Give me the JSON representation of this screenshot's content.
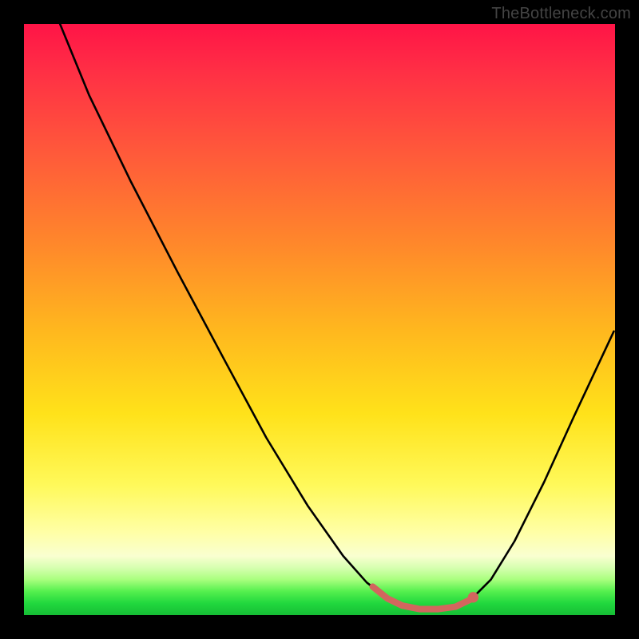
{
  "watermark": "TheBottleneck.com",
  "colors": {
    "frame": "#000000",
    "curve_stroke": "#000000",
    "highlight_stroke": "#d2665e",
    "gradient_top": "#ff1447",
    "gradient_bottom": "#16be35"
  },
  "chart_data": {
    "type": "line",
    "title": "",
    "xlabel": "",
    "ylabel": "",
    "xlim": [
      0,
      100
    ],
    "ylim": [
      0,
      100
    ],
    "curve": [
      {
        "x": 6.1,
        "y": 100.0
      },
      {
        "x": 11.0,
        "y": 88.0
      },
      {
        "x": 18.0,
        "y": 73.5
      },
      {
        "x": 26.0,
        "y": 58.0
      },
      {
        "x": 34.0,
        "y": 43.0
      },
      {
        "x": 41.0,
        "y": 30.0
      },
      {
        "x": 48.0,
        "y": 18.5
      },
      {
        "x": 54.0,
        "y": 10.0
      },
      {
        "x": 58.0,
        "y": 5.5
      },
      {
        "x": 61.5,
        "y": 2.8
      },
      {
        "x": 64.0,
        "y": 1.6
      },
      {
        "x": 67.0,
        "y": 1.0
      },
      {
        "x": 70.0,
        "y": 1.0
      },
      {
        "x": 73.0,
        "y": 1.4
      },
      {
        "x": 76.0,
        "y": 3.0
      },
      {
        "x": 79.0,
        "y": 6.0
      },
      {
        "x": 83.0,
        "y": 12.5
      },
      {
        "x": 88.0,
        "y": 22.5
      },
      {
        "x": 93.0,
        "y": 33.5
      },
      {
        "x": 99.8,
        "y": 48.0
      }
    ],
    "highlight_segment": {
      "comment": "thicker salmon segment and dot near the trough",
      "points": [
        {
          "x": 59.0,
          "y": 4.8
        },
        {
          "x": 61.5,
          "y": 2.8
        },
        {
          "x": 64.0,
          "y": 1.6
        },
        {
          "x": 67.0,
          "y": 1.0
        },
        {
          "x": 70.0,
          "y": 1.0
        },
        {
          "x": 73.0,
          "y": 1.4
        },
        {
          "x": 75.5,
          "y": 2.6
        }
      ],
      "end_dot": {
        "x": 76.0,
        "y": 3.0
      }
    }
  }
}
